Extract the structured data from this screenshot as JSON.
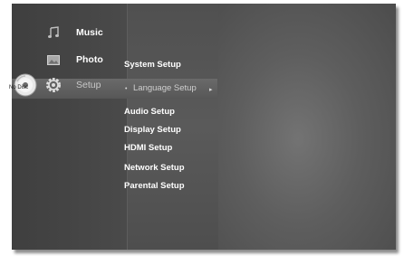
{
  "disc": {
    "label": "No Disc"
  },
  "main_menu": [
    {
      "label": "Music",
      "icon": "music-icon"
    },
    {
      "label": "Photo",
      "icon": "photo-icon"
    },
    {
      "label": "Setup",
      "icon": "gear-icon"
    }
  ],
  "sub_menu": [
    {
      "label": "System Setup"
    },
    {
      "label": "Language Setup"
    },
    {
      "label": "Audio Setup"
    },
    {
      "label": "Display Setup"
    },
    {
      "label": "HDMI Setup"
    },
    {
      "label": "Network Setup"
    },
    {
      "label": "Parental Setup"
    }
  ],
  "selected": {
    "main": "Setup",
    "sub": "Language Setup"
  }
}
